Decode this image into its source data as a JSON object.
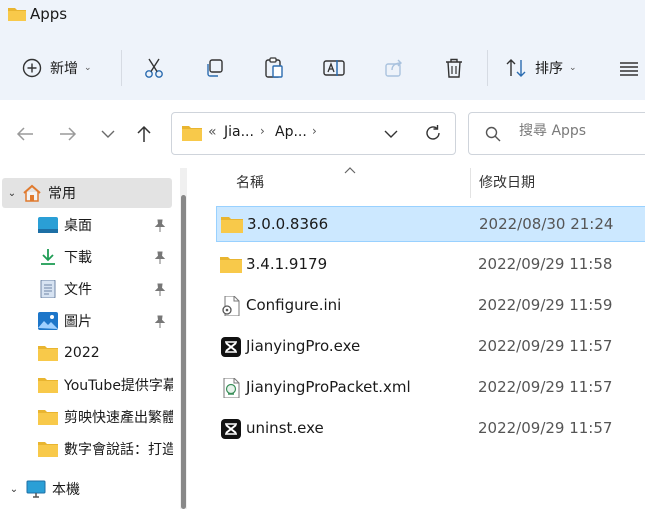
{
  "window": {
    "title": "Apps"
  },
  "toolbar": {
    "new_label": "新增",
    "sort_label": "排序"
  },
  "address": {
    "overflow": "«",
    "crumbs": [
      "Jia...",
      "Ap..."
    ]
  },
  "search": {
    "placeholder": "搜尋 Apps"
  },
  "sidebar": {
    "items": [
      {
        "label": "常用",
        "icon": "home-icon"
      },
      {
        "label": "桌面",
        "icon": "desktop-icon",
        "pinned": true
      },
      {
        "label": "下載",
        "icon": "download-icon",
        "pinned": true
      },
      {
        "label": "文件",
        "icon": "document-icon",
        "pinned": true
      },
      {
        "label": "圖片",
        "icon": "picture-icon",
        "pinned": true
      },
      {
        "label": "2022",
        "icon": "folder-icon"
      },
      {
        "label": "YouTube提供字幕",
        "icon": "folder-icon"
      },
      {
        "label": "剪映快速產出繁體",
        "icon": "folder-icon"
      },
      {
        "label": "數字會說話：打造",
        "icon": "folder-icon"
      },
      {
        "label": "本機",
        "icon": "computer-icon"
      }
    ]
  },
  "filelist": {
    "columns": {
      "name": "名稱",
      "modified": "修改日期"
    },
    "rows": [
      {
        "name": "3.0.0.8366",
        "modified": "2022/08/30 21:24",
        "icon": "folder-icon",
        "selected": true
      },
      {
        "name": "3.4.1.9179",
        "modified": "2022/09/29 11:58",
        "icon": "folder-icon"
      },
      {
        "name": "Configure.ini",
        "modified": "2022/09/29 11:59",
        "icon": "ini-file-icon"
      },
      {
        "name": "JianyingPro.exe",
        "modified": "2022/09/29 11:57",
        "icon": "capcut-app-icon"
      },
      {
        "name": "JianyingProPacket.xml",
        "modified": "2022/09/29 11:57",
        "icon": "xml-file-icon"
      },
      {
        "name": "uninst.exe",
        "modified": "2022/09/29 11:57",
        "icon": "capcut-app-icon"
      }
    ]
  },
  "colors": {
    "chrome_bg": "#eef3fa",
    "selection_bg": "#cce8ff",
    "selection_border": "#99d1ff",
    "folder": "#f8c94a"
  }
}
